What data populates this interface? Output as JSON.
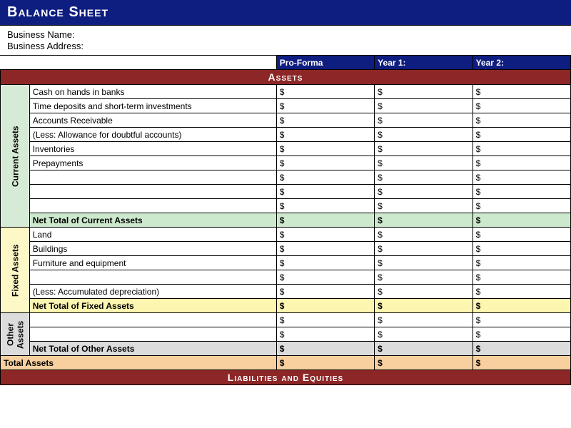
{
  "title": "Balance Sheet",
  "business_name_label": "Business Name:",
  "business_address_label": "Business Address:",
  "columns": {
    "proforma": "Pro-Forma",
    "year1": "Year 1:",
    "year2": "Year 2:"
  },
  "sections": {
    "assets_header": "Assets",
    "liabilities_header": "Liabilities and Equities"
  },
  "groups": {
    "current_assets": {
      "label": "Current Assets",
      "rows": [
        "Cash on hands in banks",
        "Time deposits and short-term investments",
        "Accounts Receivable",
        "(Less: Allowance for doubtful accounts)",
        "Inventories",
        "Prepayments",
        "",
        "",
        ""
      ],
      "total_label": "Net Total of Current Assets"
    },
    "fixed_assets": {
      "label": "Fixed Assets",
      "rows": [
        "Land",
        "Buildings",
        "Furniture and equipment",
        "",
        "(Less: Accumulated depreciation)"
      ],
      "total_label": "Net Total of Fixed Assets"
    },
    "other_assets": {
      "label": "Other Assets",
      "rows": [
        "",
        ""
      ],
      "total_label": "Net Total of Other Assets"
    }
  },
  "grand_total_label": "Total Assets",
  "currency": "$"
}
